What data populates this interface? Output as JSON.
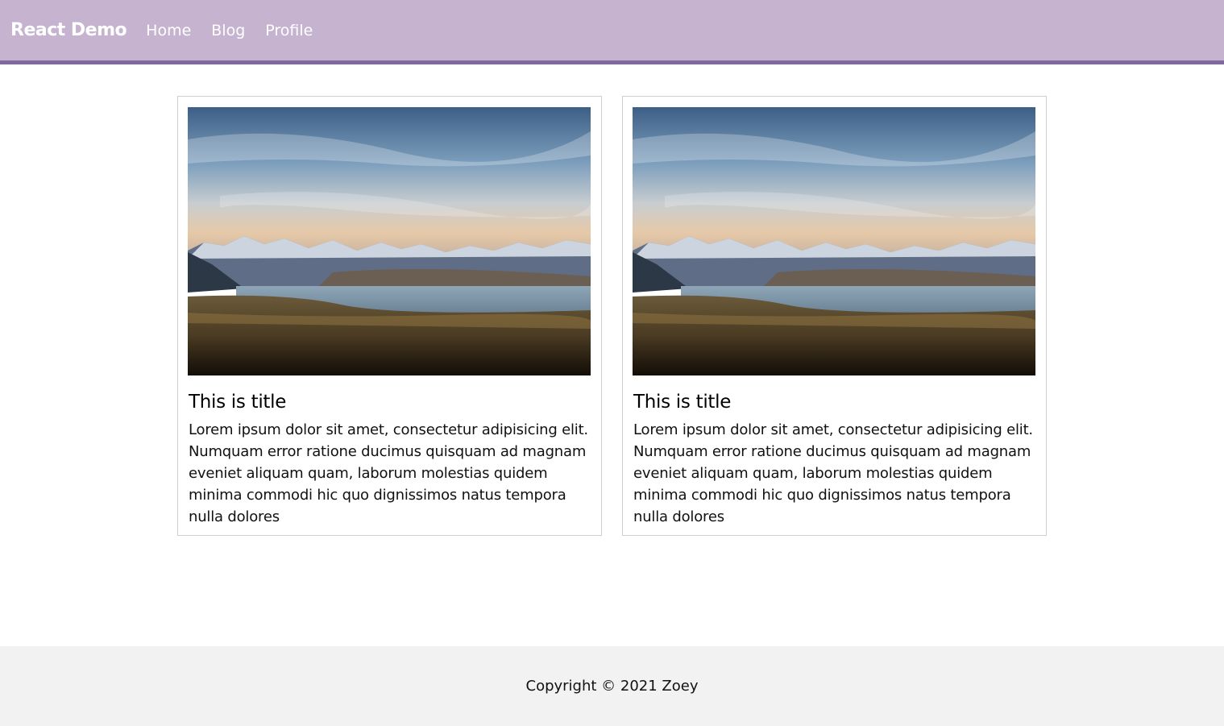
{
  "colors": {
    "navbar_bg": "#c6b3d0",
    "navbar_border": "#7e6aa0",
    "footer_bg": "#f2f2f2"
  },
  "navbar": {
    "brand": "React Demo",
    "links": [
      "Home",
      "Blog",
      "Profile"
    ]
  },
  "cards": [
    {
      "image": "mountain-lake-landscape",
      "title": "This is title",
      "text": "Lorem ipsum dolor sit amet, consectetur adipisicing elit. Numquam error ratione ducimus quisquam ad magnam eveniet aliquam quam, laborum molestias quidem minima commodi hic quo dignissimos natus tempora nulla dolores"
    },
    {
      "image": "mountain-lake-landscape",
      "title": "This is title",
      "text": "Lorem ipsum dolor sit amet, consectetur adipisicing elit. Numquam error ratione ducimus quisquam ad magnam eveniet aliquam quam, laborum molestias quidem minima commodi hic quo dignissimos natus tempora nulla dolores"
    }
  ],
  "footer": {
    "text": "Copyright © 2021 Zoey"
  }
}
